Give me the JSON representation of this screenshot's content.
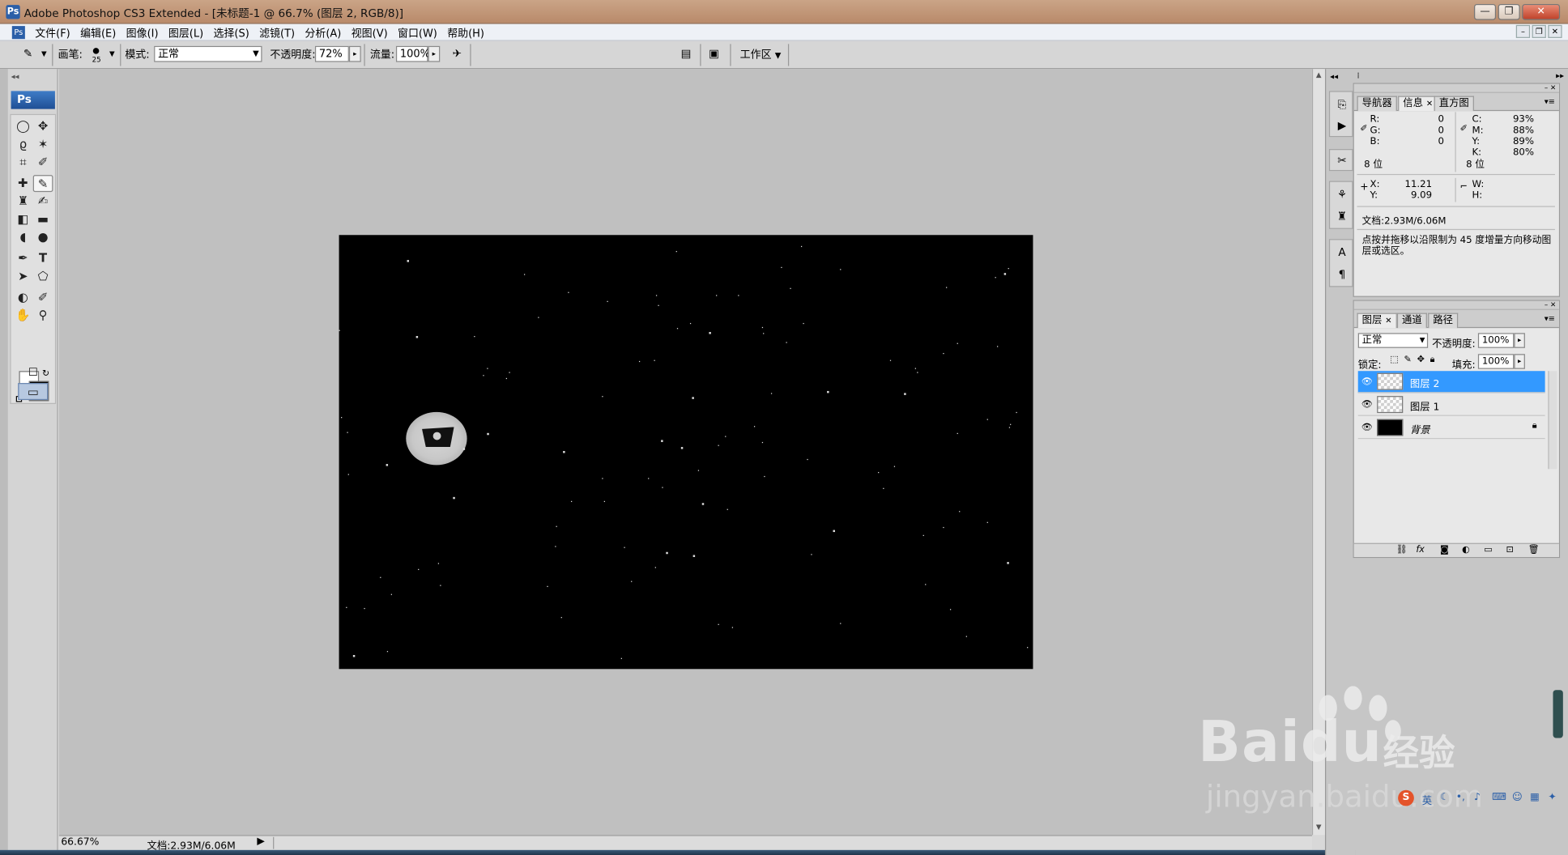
{
  "window": {
    "title": "Adobe Photoshop CS3 Extended - [未标题-1 @ 66.7% (图层 2, RGB/8)]",
    "app_icon": "Ps",
    "controls": [
      "minimize-icon",
      "restore-icon",
      "close-icon"
    ]
  },
  "menu": {
    "items": [
      "文件(F)",
      "编辑(E)",
      "图像(I)",
      "图层(L)",
      "选择(S)",
      "滤镜(T)",
      "分析(A)",
      "视图(V)",
      "窗口(W)",
      "帮助(H)"
    ]
  },
  "options_bar": {
    "brush_label": "画笔:",
    "brush_size": "25",
    "mode_label": "模式:",
    "mode_value": "正常",
    "opacity_label": "不透明度:",
    "opacity_value": "72%",
    "flow_label": "流量:",
    "flow_value": "100%",
    "workspace_label": "工作区"
  },
  "toolbox": {
    "logo": "Ps",
    "tools": [
      "marquee-icon",
      "move-icon",
      "lasso-icon",
      "magic-wand-icon",
      "crop-icon",
      "slice-icon",
      "healing-brush-icon",
      "brush-icon",
      "clone-stamp-icon",
      "history-brush-icon",
      "eraser-icon",
      "gradient-icon",
      "blur-icon",
      "dodge-icon",
      "pen-icon",
      "type-icon",
      "path-selection-icon",
      "shape-icon",
      "3d-rotate-icon",
      "eyedropper-icon",
      "hand-icon",
      "zoom-icon"
    ],
    "active_tool": "brush-icon",
    "foreground_color": "#ffffff",
    "background_color": "#000000"
  },
  "document": {
    "canvas_color": "#000000",
    "planet_color": "#c8c8c8"
  },
  "status": {
    "zoom": "66.67%",
    "doc_size": "文档:2.93M/6.06M"
  },
  "info_panel": {
    "tabs": [
      "导航器",
      "信息",
      "直方图"
    ],
    "active_tab": "信息",
    "rgb": [
      {
        "label": "R:",
        "value": "0"
      },
      {
        "label": "G:",
        "value": "0"
      },
      {
        "label": "B:",
        "value": "0"
      }
    ],
    "cmyk": [
      {
        "label": "C:",
        "value": "93%"
      },
      {
        "label": "M:",
        "value": "88%"
      },
      {
        "label": "Y:",
        "value": "89%"
      },
      {
        "label": "K:",
        "value": "80%"
      }
    ],
    "bit_depth_left": "8 位",
    "bit_depth_right": "8 位",
    "x_label": "X:",
    "x_value": "11.21",
    "y_label": "Y:",
    "y_value": "9.09",
    "w_label": "W:",
    "h_label": "H:",
    "doc_info": "文档:2.93M/6.06M",
    "hint": "点按并拖移以沿限制为 45 度增量方向移动图层或选区。"
  },
  "layers_panel": {
    "tabs": [
      "图层",
      "通道",
      "路径"
    ],
    "active_tab": "图层",
    "blend_mode": "正常",
    "opacity_label": "不透明度:",
    "opacity_value": "100%",
    "lock_label": "锁定:",
    "fill_label": "填充:",
    "fill_value": "100%",
    "layers": [
      {
        "name": "图层 2",
        "selected": true
      },
      {
        "name": "图层 1",
        "selected": false
      },
      {
        "name": "背景",
        "selected": false,
        "locked": true
      }
    ]
  },
  "watermark": {
    "brand": "Bai",
    "brand_tail": "du",
    "cn": "经验",
    "url": "jingyan.baidu.com"
  },
  "tray": {
    "ime": "英"
  }
}
